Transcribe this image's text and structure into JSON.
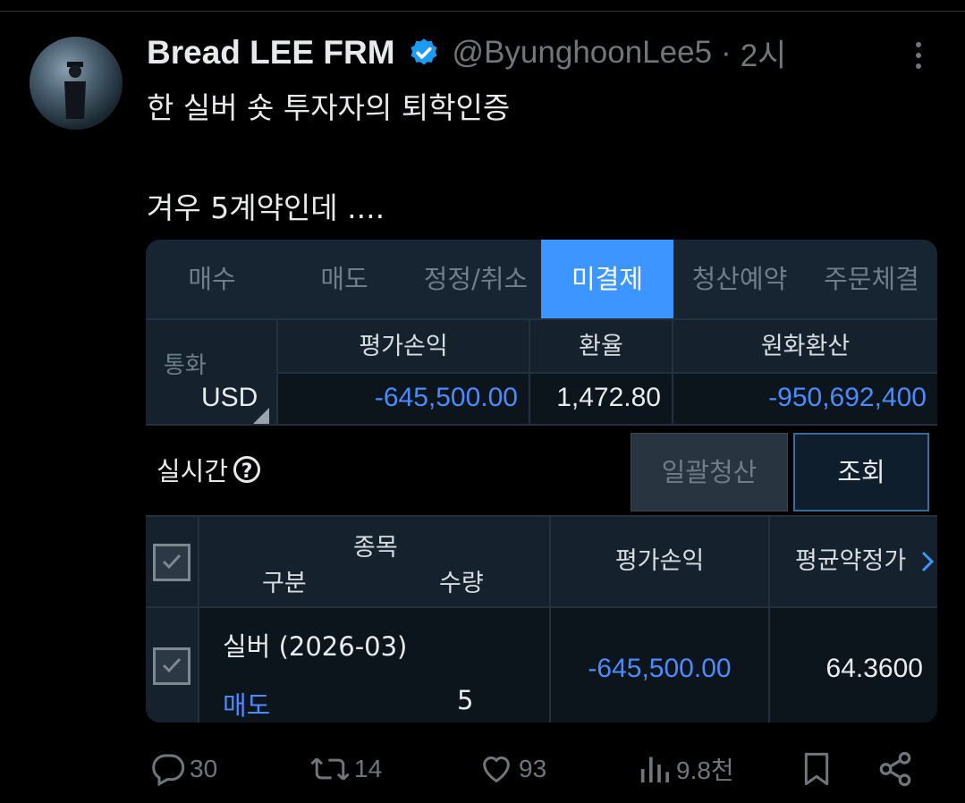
{
  "tweet": {
    "author_name": "Bread LEE FRM",
    "handle": "@ByunghoonLee5",
    "separator": "·",
    "time": "2시",
    "text_line1": "한 실버 숏 투자자의 퇴학인증",
    "text_line2": "겨우 5계약인데 ...."
  },
  "screenshot": {
    "tabs": [
      "매수",
      "매도",
      "정정/취소",
      "미결제",
      "청산예약",
      "주문체결"
    ],
    "active_tab": "미결제",
    "summary": {
      "currency_label": "통화",
      "currency_value": "USD",
      "headers": [
        "평가손익",
        "환율",
        "원화환산"
      ],
      "pnl": "-645,500.00",
      "fx_rate": "1,472.80",
      "krw_value": "-950,692,400"
    },
    "realtime_label": "실시간",
    "help_glyph": "?",
    "buttons": {
      "liquidate_all": "일괄청산",
      "inquire": "조회"
    },
    "positions_table": {
      "headers": {
        "item": "종목",
        "side": "구분",
        "qty": "수량",
        "pnl": "평가손익",
        "avg_price": "평균약정가"
      },
      "rows": [
        {
          "item": "실버 (2026-03)",
          "side": "매도",
          "qty": "5",
          "pnl": "-645,500.00",
          "avg_price": "64.3600"
        }
      ]
    },
    "colors": {
      "active_tab": "#3d95ff",
      "negative": "#4a8cff",
      "side_sell": "#4a8cff"
    }
  },
  "actions": {
    "replies": "30",
    "reposts": "14",
    "likes": "93",
    "views": "9.8천"
  }
}
